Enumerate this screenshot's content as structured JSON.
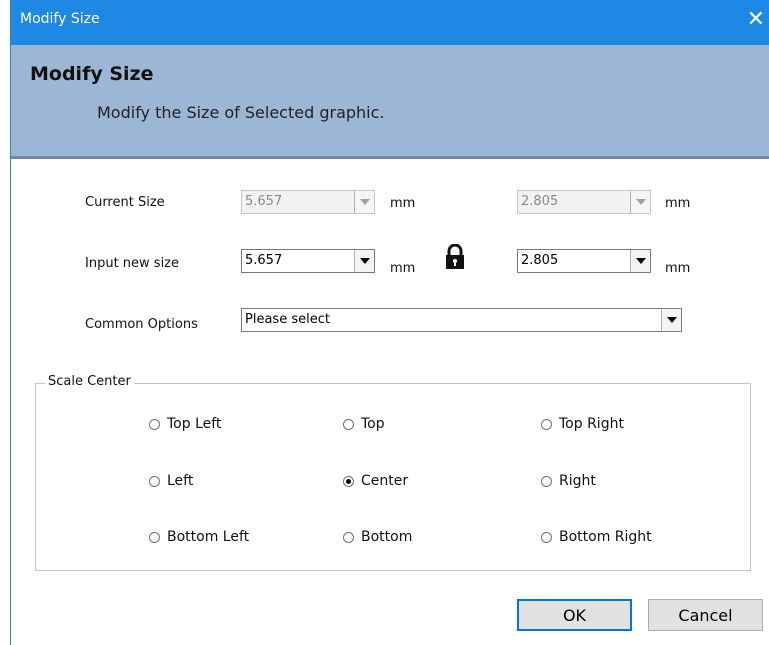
{
  "window": {
    "title": "Modify Size",
    "close_glyph": "✕"
  },
  "header": {
    "title": "Modify Size",
    "subtitle": "Modify the Size of Selected graphic."
  },
  "current_size": {
    "label": "Current Size",
    "width": "5.657",
    "height": "2.805",
    "unit": "mm"
  },
  "input_size": {
    "label": "Input new size",
    "width": "5.657",
    "height": "2.805",
    "unit": "mm",
    "lock_icon": "lock-icon"
  },
  "common_options": {
    "label": "Common Options",
    "selected": "Please select"
  },
  "scale_center": {
    "legend": "Scale Center",
    "selected": "Center",
    "options": [
      "Top Left",
      "Top",
      "Top Right",
      "Left",
      "Center",
      "Right",
      "Bottom Left",
      "Bottom",
      "Bottom Right"
    ]
  },
  "buttons": {
    "ok": "OK",
    "cancel": "Cancel"
  },
  "colors": {
    "titlebar": "#1e88e5",
    "header": "#9cb6d6",
    "accent": "#0078d7"
  }
}
